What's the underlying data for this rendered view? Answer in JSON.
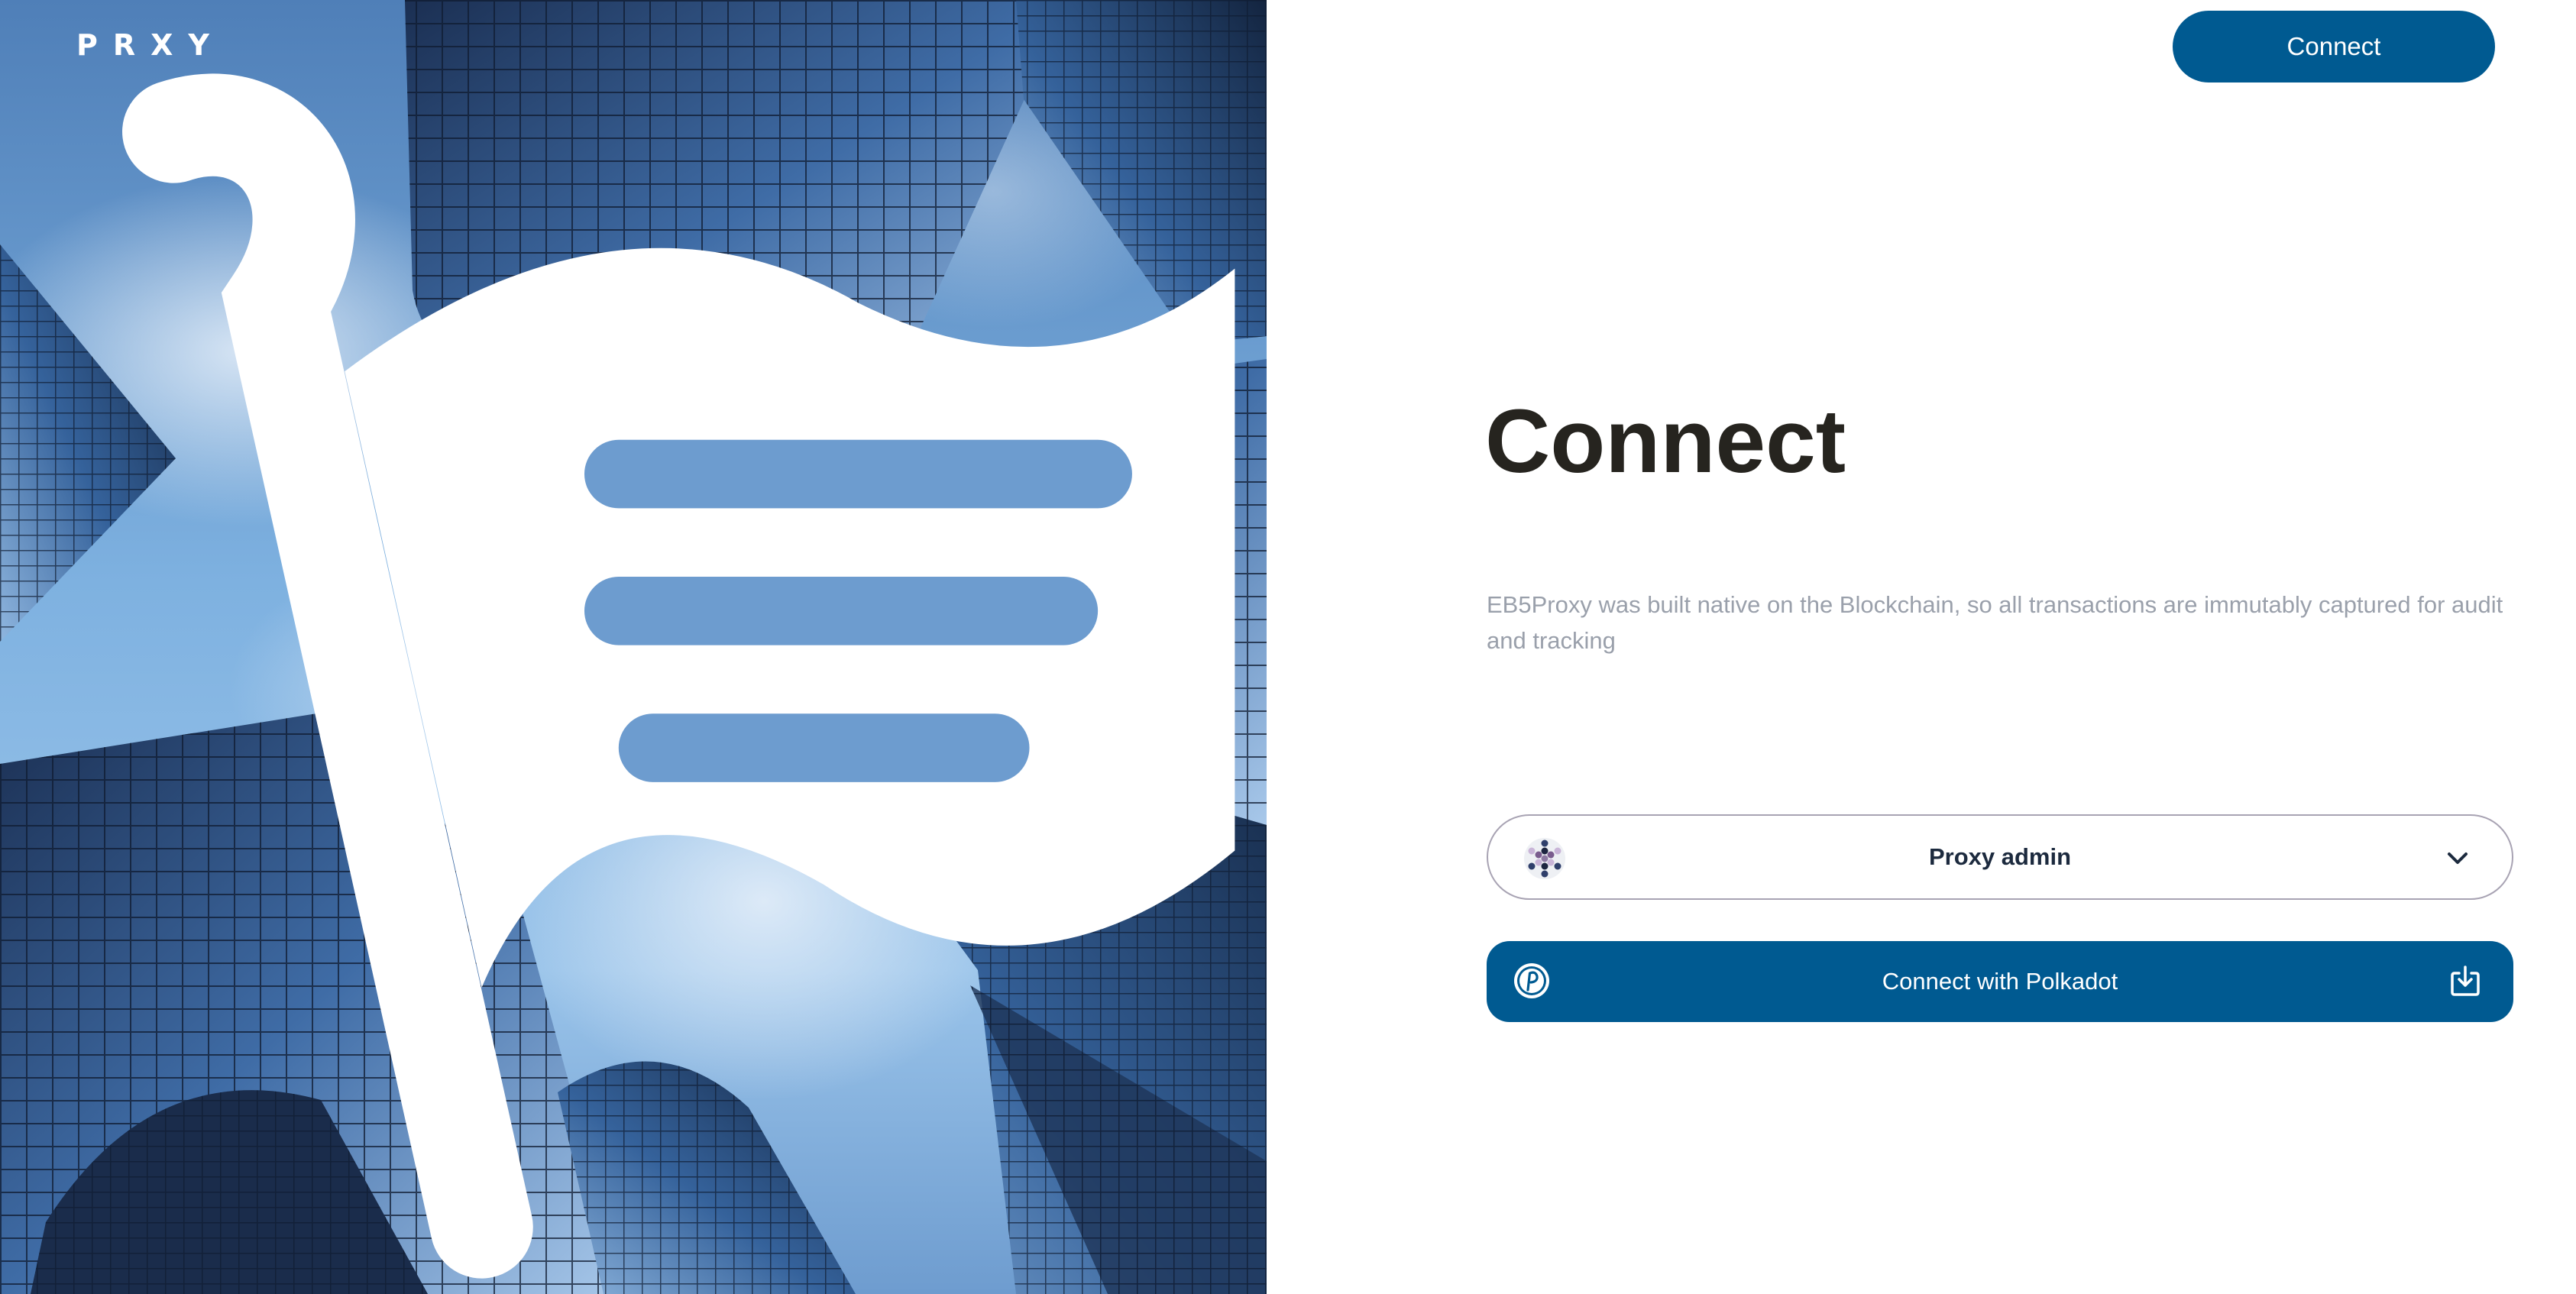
{
  "brand": {
    "name": "PRXY",
    "logo_icon": "flag-logo-icon"
  },
  "header": {
    "connect_label": "Connect",
    "accent_color": "#005a91"
  },
  "main": {
    "title": "Connect",
    "description": "EB5Proxy was built native on the Blockchain, so all transactions are immutably captured for audit and tracking",
    "account_select": {
      "selected": "Proxy admin",
      "icon": "identicon-icon",
      "chevron_icon": "chevron-down-icon"
    },
    "polkadot_button": {
      "label": "Connect with Polkadot",
      "icon": "polkadot-icon",
      "action_icon": "download-icon"
    }
  },
  "hero": {
    "image": "skyscrapers-photo"
  }
}
